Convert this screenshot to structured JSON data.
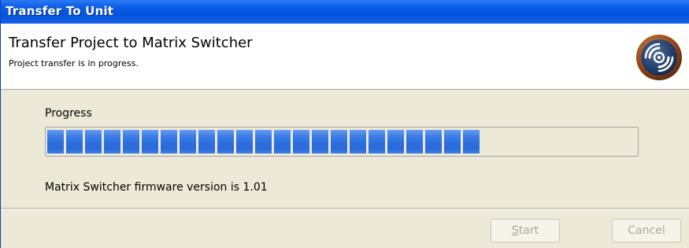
{
  "window": {
    "title": "Transfer To Unit"
  },
  "header": {
    "heading": "Transfer Project to Matrix Switcher",
    "subheading": "Project transfer is in progress.",
    "icon": "disc-transfer-icon"
  },
  "progress": {
    "label": "Progress",
    "fraction": 0.73,
    "filled_blocks": 23
  },
  "status": {
    "firmware_text": "Matrix Switcher firmware version is 1.01"
  },
  "buttons": {
    "start_mnemonic": "S",
    "start_rest": "tart",
    "start_label": "Start",
    "cancel_label": "Cancel"
  },
  "colors": {
    "titlebar": "#0a5ee6",
    "progress_fill": "#2b6fdf",
    "dialog_bg": "#ece9d8",
    "disabled_text": "#aca899"
  }
}
